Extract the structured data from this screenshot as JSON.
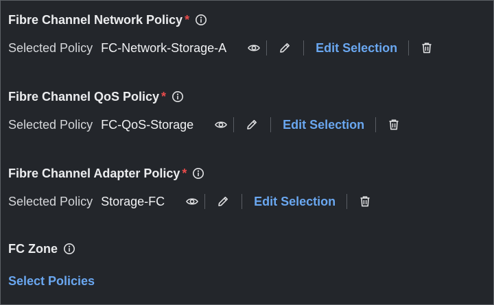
{
  "sections": [
    {
      "title": "Fibre Channel Network Policy",
      "required_mark": "*",
      "selected_label": "Selected Policy",
      "selected_value": "FC-Network-Storage-A",
      "edit_label": "Edit Selection"
    },
    {
      "title": "Fibre Channel QoS Policy",
      "required_mark": "*",
      "selected_label": "Selected Policy",
      "selected_value": "FC-QoS-Storage",
      "edit_label": "Edit Selection"
    },
    {
      "title": "Fibre Channel Adapter Policy",
      "required_mark": "*",
      "selected_label": "Selected Policy",
      "selected_value": "Storage-FC",
      "edit_label": "Edit Selection"
    }
  ],
  "fc_zone": {
    "title": "FC Zone",
    "select_label": "Select Policies"
  },
  "colors": {
    "background": "#23262b",
    "link": "#6aa7f0",
    "required": "#e84b4b",
    "text": "#ecedef"
  },
  "icons": [
    "info-icon",
    "eye-icon",
    "pencil-icon",
    "trash-icon"
  ]
}
